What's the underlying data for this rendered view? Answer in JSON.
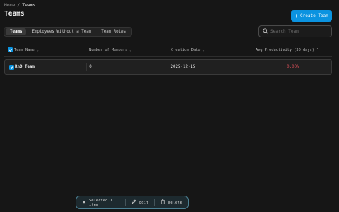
{
  "breadcrumb": {
    "home": "Home",
    "separator": "/",
    "current": "Teams"
  },
  "page": {
    "title": "Teams"
  },
  "create_button": {
    "label": "Create Team"
  },
  "tabs": [
    {
      "label": "Teams",
      "active": true
    },
    {
      "label": "Employees Without a Team",
      "active": false
    },
    {
      "label": "Team Roles",
      "active": false
    }
  ],
  "search": {
    "placeholder": "Search Team",
    "value": ""
  },
  "table": {
    "columns": {
      "name": "Team Name",
      "members": "Number of Members",
      "date": "Creation Date",
      "productivity": "Avg Productivity (30 days)"
    },
    "rows": [
      {
        "name": "RnD Team",
        "members": "0",
        "date": "2025-12-15",
        "productivity": "0.00%",
        "selected": true
      }
    ]
  },
  "action_bar": {
    "selected_label": "Selected 1 item",
    "edit_label": "Edit",
    "delete_label": "Delete"
  },
  "colors": {
    "accent": "#0b93e0",
    "negative": "#e0505a",
    "background": "#161616"
  }
}
